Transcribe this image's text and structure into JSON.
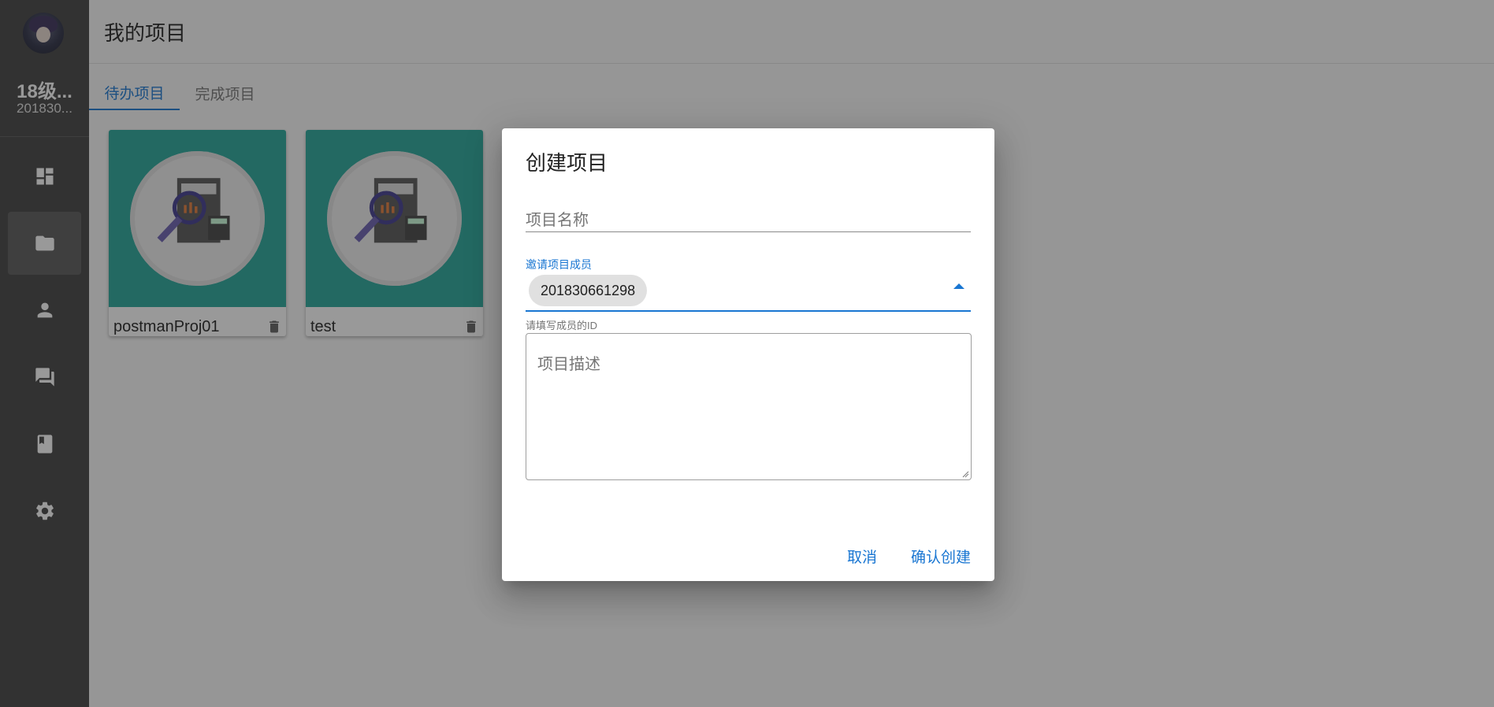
{
  "sidebar": {
    "user_name": "18级...",
    "user_id": "201830...",
    "nav_icons": [
      "dashboard-icon",
      "folder-icon",
      "person-icon",
      "forum-icon",
      "book-icon",
      "settings-icon"
    ],
    "active_index": 1
  },
  "header": {
    "title": "我的项目"
  },
  "tabs": [
    {
      "label": "待办项目",
      "active": true
    },
    {
      "label": "完成项目",
      "active": false
    }
  ],
  "projects": [
    {
      "name": "postmanProj01"
    },
    {
      "name": "test"
    }
  ],
  "dialog": {
    "title": "创建项目",
    "name_placeholder": "项目名称",
    "members_label": "邀请项目成员",
    "member_chip": "201830661298",
    "members_hint": "请填写成员的ID",
    "description_placeholder": "项目描述",
    "cancel_label": "取消",
    "confirm_label": "确认创建"
  },
  "colors": {
    "sidebar_bg": "#424242",
    "accent": "#1976d2",
    "card_cover": "#26a69a"
  }
}
